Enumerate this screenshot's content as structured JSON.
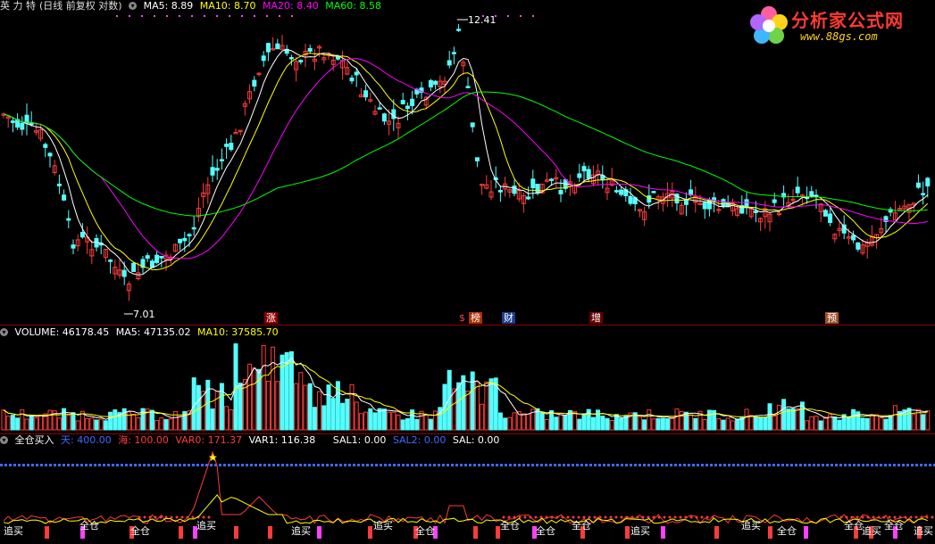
{
  "main_panel": {
    "stock_name": "英 力 特",
    "adjust_mode": "(日线 前复权 对数)",
    "ma5": "MA5: 8.89",
    "ma10": "MA10: 8.70",
    "ma20": "MA20: 8.40",
    "ma60": "MA60: 8.58",
    "high_label": "12.41",
    "low_label": "7.01",
    "event_flags": [
      "涨",
      "$",
      "榜",
      "财",
      "增",
      "预"
    ]
  },
  "volume_panel": {
    "volume": "VOLUME: 46178.45",
    "ma5": "MA5: 47135.02",
    "ma10": "MA10: 37585.70"
  },
  "indicator_panel": {
    "name": "全仓买入",
    "tian": "天: 400.00",
    "hai": "海: 100.00",
    "var0": "VAR0: 171.37",
    "var1": "VAR1: 116.38",
    "sal1": "SAL1: 0.00",
    "sal2": "SAL2: 0.00",
    "sal": "SAL: 0.00",
    "signals": [
      "追买",
      "全仓",
      "全仓",
      "追买",
      "追买",
      "追买",
      "全仓",
      "全仓",
      "全仓",
      "全仓",
      "追买",
      "追买",
      "全仓",
      "全仓",
      "追买",
      "全仓",
      "追买"
    ]
  },
  "logo": {
    "brand": "分析家公式网",
    "url": "www.88gs.com"
  },
  "colors": {
    "up": "#ff3b3b",
    "down": "#54ffff",
    "ma5": "#ffffff",
    "ma10": "#ffff00",
    "ma20": "#ff00ff",
    "ma60": "#00ff00",
    "sal2": "#3b6bff"
  },
  "chart_data": {
    "type": "candlestick",
    "price_high": 12.41,
    "price_low": 7.01,
    "price_range": [
      6.7,
      13.0
    ]
  }
}
